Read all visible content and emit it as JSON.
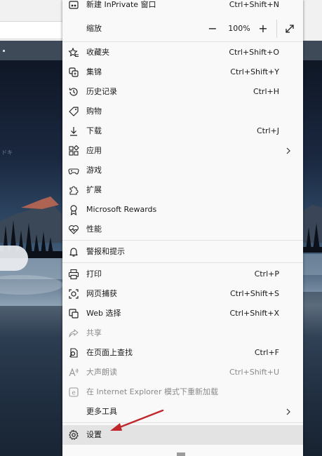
{
  "menu": {
    "inprivate": {
      "label": "新建 InPrivate 窗口",
      "shortcut": "Ctrl+Shift+N",
      "icon": "inprivate-window-icon"
    },
    "zoom": {
      "label": "缩放",
      "value": "100%",
      "minus": "−",
      "plus": "+",
      "icon": "fullscreen-icon"
    },
    "favorites": {
      "label": "收藏夹",
      "shortcut": "Ctrl+Shift+O",
      "icon": "favorites-icon"
    },
    "collections": {
      "label": "集锦",
      "shortcut": "Ctrl+Shift+Y",
      "icon": "collections-icon"
    },
    "history": {
      "label": "历史记录",
      "shortcut": "Ctrl+H",
      "icon": "history-icon"
    },
    "shopping": {
      "label": "购物",
      "icon": "shopping-tag-icon"
    },
    "downloads": {
      "label": "下载",
      "shortcut": "Ctrl+J",
      "icon": "download-icon"
    },
    "apps": {
      "label": "应用",
      "icon": "apps-icon"
    },
    "games": {
      "label": "游戏",
      "icon": "games-icon"
    },
    "extensions": {
      "label": "扩展",
      "icon": "extensions-icon"
    },
    "rewards": {
      "label": "Microsoft Rewards",
      "icon": "rewards-icon"
    },
    "performance": {
      "label": "性能",
      "icon": "performance-icon"
    },
    "alerts": {
      "label": "警报和提示",
      "icon": "bell-icon"
    },
    "print": {
      "label": "打印",
      "shortcut": "Ctrl+P",
      "icon": "print-icon"
    },
    "webcapture": {
      "label": "网页捕获",
      "shortcut": "Ctrl+Shift+S",
      "icon": "web-capture-icon"
    },
    "webselect": {
      "label": "Web 选择",
      "shortcut": "Ctrl+Shift+X",
      "icon": "web-select-icon"
    },
    "share": {
      "label": "共享",
      "icon": "share-icon"
    },
    "find": {
      "label": "在页面上查找",
      "shortcut": "Ctrl+F",
      "icon": "find-icon"
    },
    "readaloud": {
      "label": "大声朗读",
      "shortcut": "Ctrl+Shift+U",
      "icon": "read-aloud-icon"
    },
    "ie_mode": {
      "label": "在 Internet Explorer 模式下重新加载",
      "icon": "ie-icon"
    },
    "more_tools": {
      "label": "更多工具",
      "icon": "chevron-right-icon"
    },
    "settings": {
      "label": "设置",
      "icon": "gear-icon"
    }
  },
  "background": {
    "faint_text": "ドキ"
  },
  "colors": {
    "menu_bg": "#f9f9f9",
    "highlight": "#e3e3e3",
    "arrow": "#c0272d",
    "disabled_text": "#8a8a8a"
  }
}
